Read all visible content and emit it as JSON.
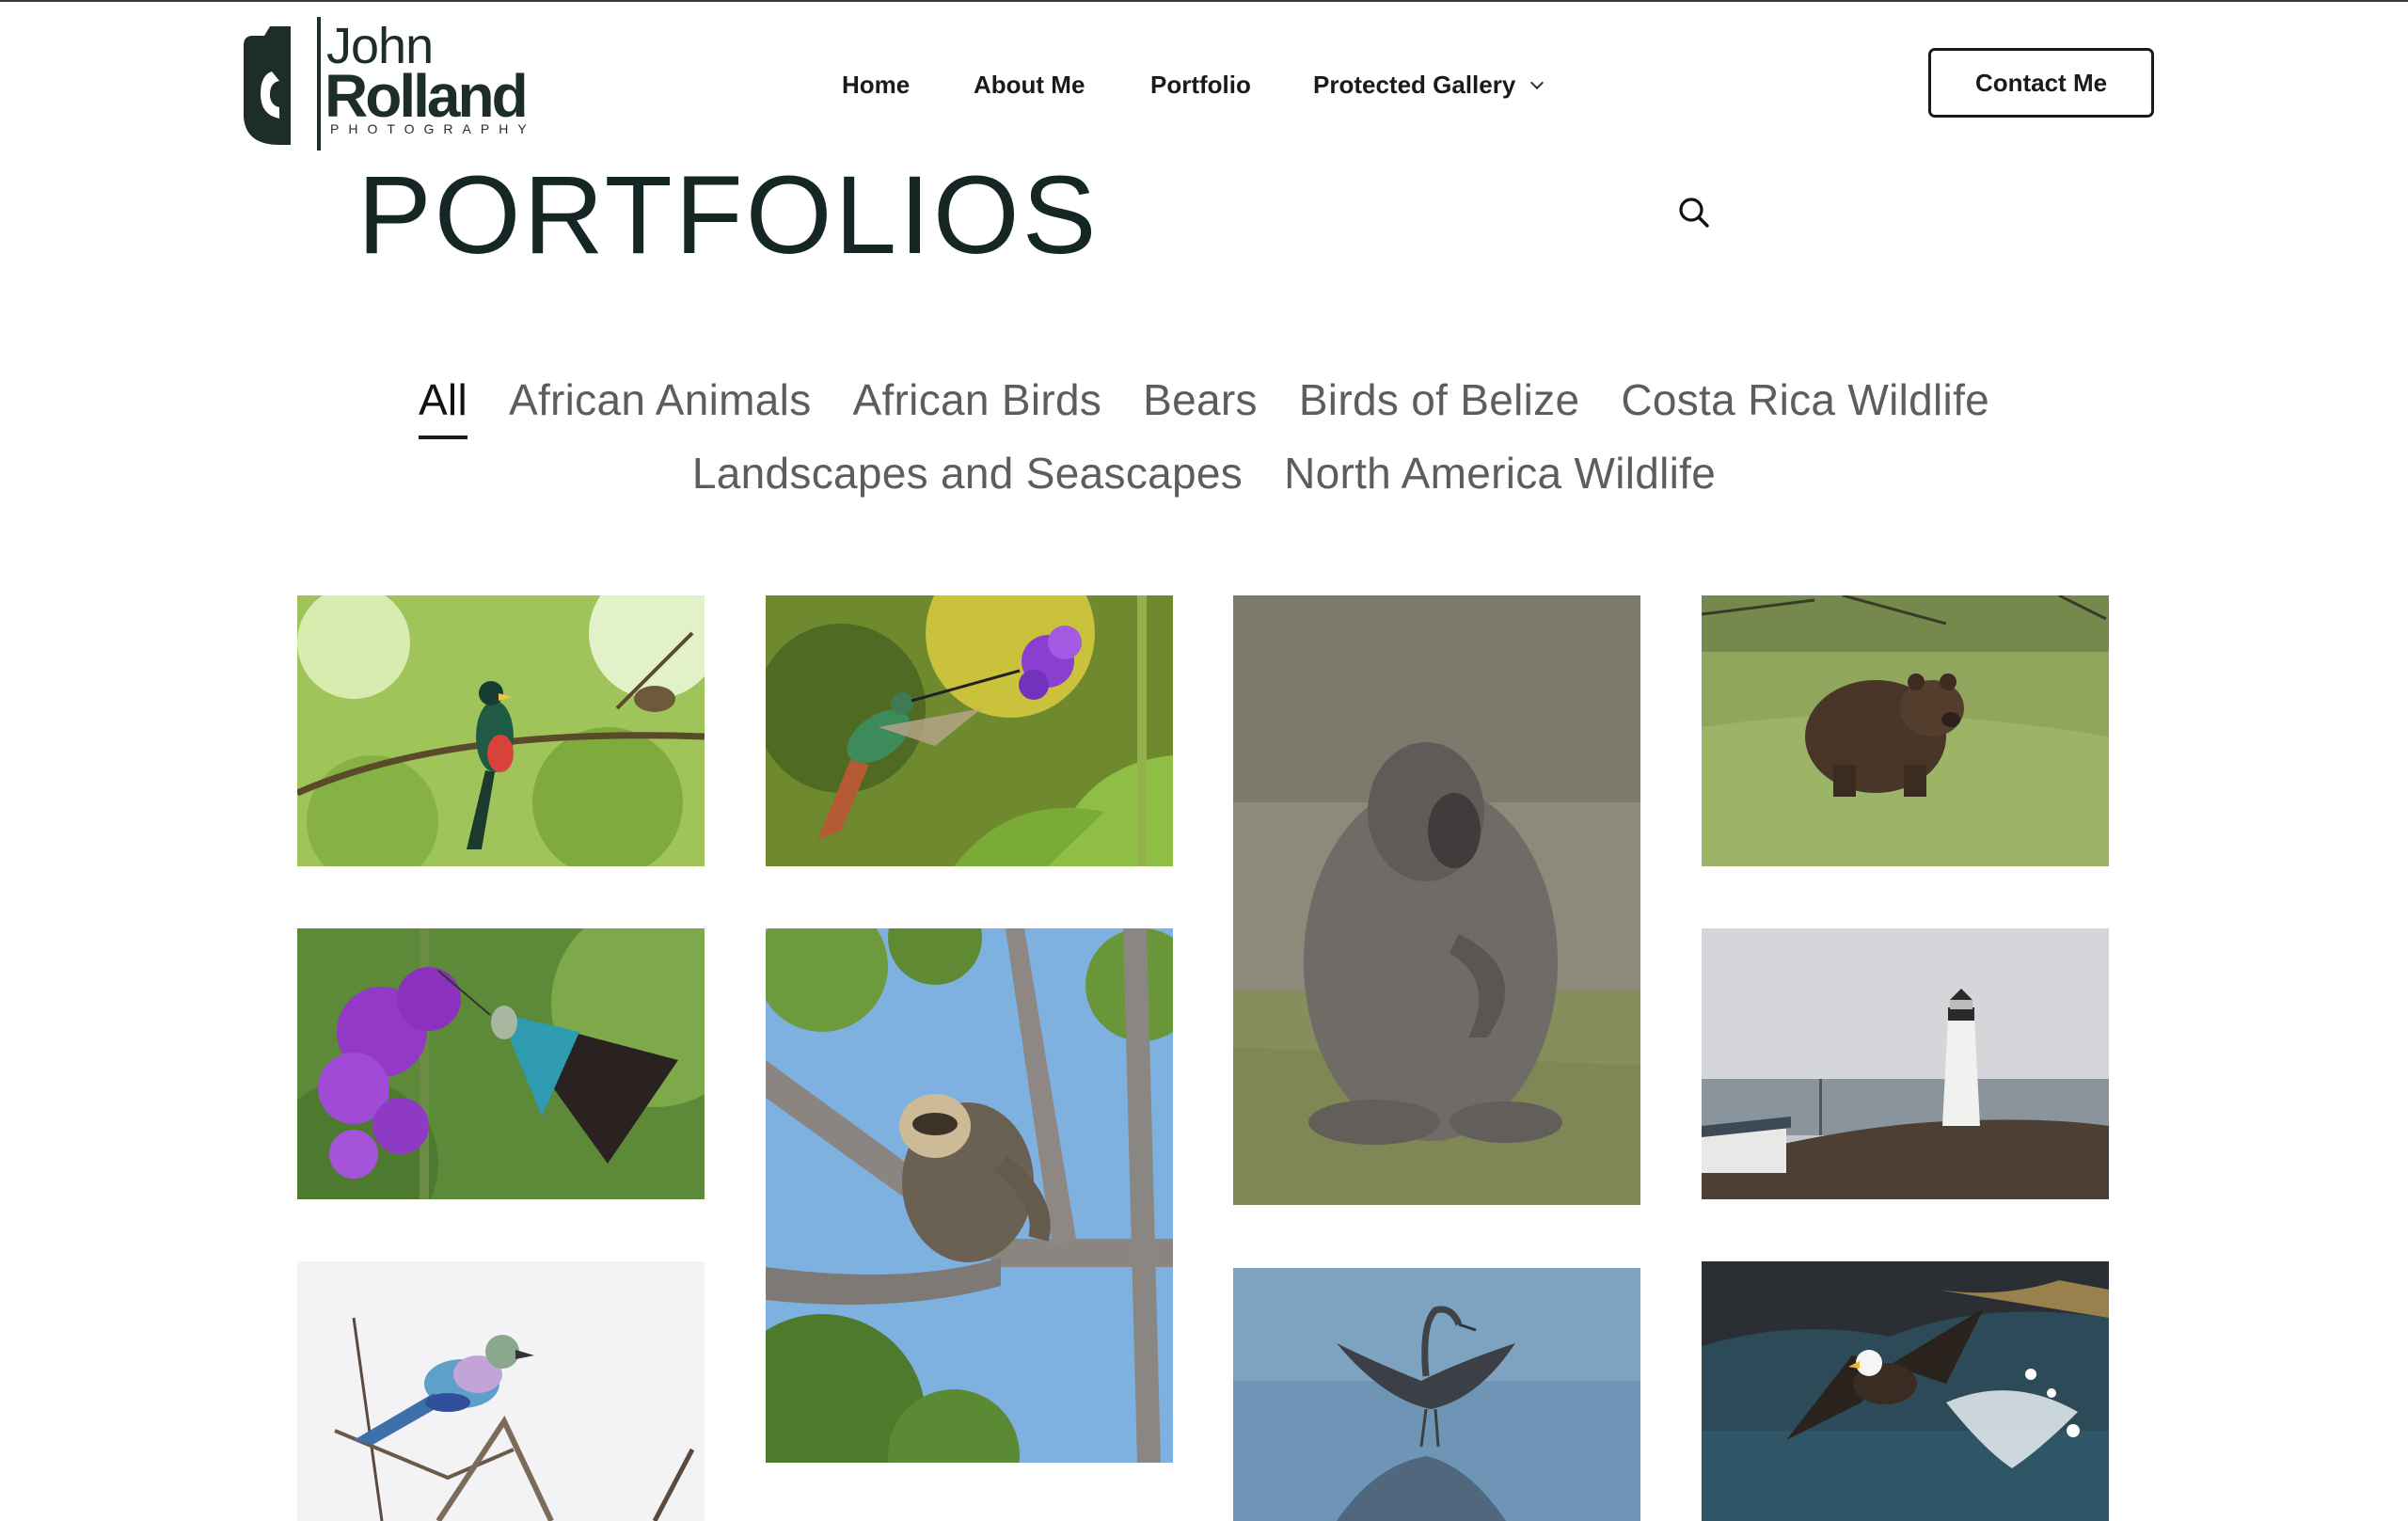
{
  "brand": {
    "name_line1": "John",
    "name_line2": "Rolland",
    "tagline": "PHOTOGRAPHY",
    "color": "#1d2e2a"
  },
  "nav": {
    "items": [
      {
        "label": "Home"
      },
      {
        "label": "About Me"
      },
      {
        "label": "Portfolio"
      },
      {
        "label": "Protected Gallery",
        "has_dropdown": true
      }
    ],
    "contact_label": "Contact Me"
  },
  "page": {
    "title": "PORTFOLIOS",
    "search_icon": "search-icon"
  },
  "filters": {
    "active": "All",
    "rows": [
      [
        "All",
        "African Animals",
        "African Birds",
        "Bears",
        "Birds of Belize",
        "Costa Rica Wildlife"
      ],
      [
        "Landscapes and Seascapes",
        "North America Wildlife"
      ]
    ]
  },
  "gallery": {
    "tiles": [
      {
        "subject": "trogon-bird-on-branch"
      },
      {
        "subject": "hummingbird-at-purple-flower"
      },
      {
        "subject": "baboon-sitting-in-grass"
      },
      {
        "subject": "brown-bear-in-meadow"
      },
      {
        "subject": "butterfly-on-purple-flower"
      },
      {
        "subject": "sloth-in-tree"
      },
      {
        "subject": "lighthouse-on-coast"
      },
      {
        "subject": "lilac-breasted-roller"
      },
      {
        "subject": "heron-drying-wings"
      },
      {
        "subject": "bald-eagle-catching-fish"
      }
    ]
  },
  "colors": {
    "text_dark": "#142725",
    "filter_inactive": "#5d5d5d",
    "accent": "#1c1c1c"
  }
}
